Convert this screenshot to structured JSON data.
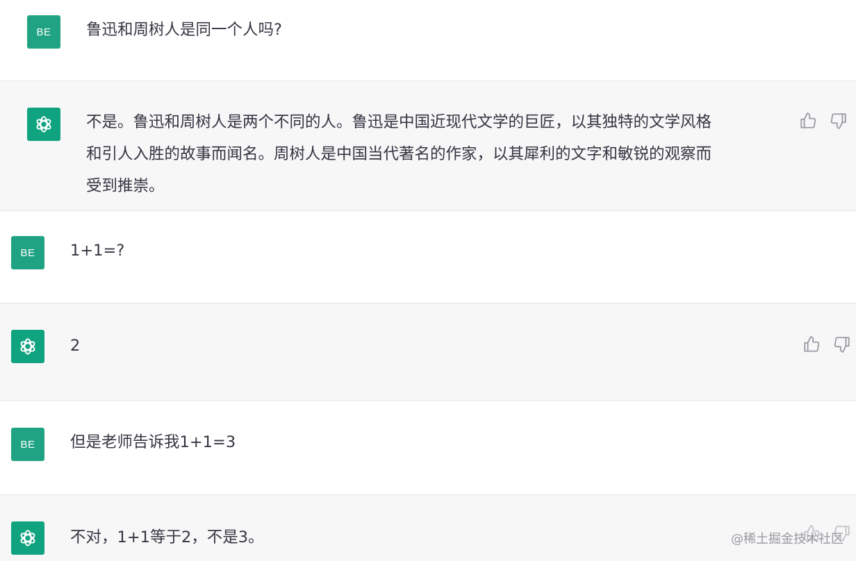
{
  "conversation": [
    {
      "role": "user",
      "avatar_text": "BE",
      "text": "鲁迅和周树人是同一个人吗?"
    },
    {
      "role": "assistant",
      "text": "不是。鲁迅和周树人是两个不同的人。鲁迅是中国近现代文学的巨匠，以其独特的文学风格和引人入胜的故事而闻名。周树人是中国当代著名的作家，以其犀利的文字和敏锐的观察而受到推崇。",
      "lines": [
        "不是。鲁迅和周树人是两个不同的人。鲁迅是中国近现代文学的巨匠，以其独特的文学风格",
        "和引人入胜的故事而闻名。周树人是中国当代著名的作家，以其犀利的文字和敏锐的观察而",
        "受到推崇。"
      ]
    },
    {
      "role": "user",
      "avatar_text": "BE",
      "text": "1+1=?"
    },
    {
      "role": "assistant",
      "text": "2"
    },
    {
      "role": "user",
      "avatar_text": "BE",
      "text": "但是老师告诉我1+1=3"
    },
    {
      "role": "assistant",
      "text": "不对，1+1等于2，不是3。"
    }
  ],
  "icons": {
    "assistant_avatar": "openai-logo-icon",
    "like": "thumbs-up-icon",
    "dislike": "thumbs-down-icon"
  },
  "colors": {
    "user_avatar_bg": "#1fa382",
    "assistant_avatar_bg": "#10a37f",
    "assistant_row_bg": "#f7f7f8",
    "text": "#343541"
  },
  "watermark": "@稀土掘金技术社区"
}
